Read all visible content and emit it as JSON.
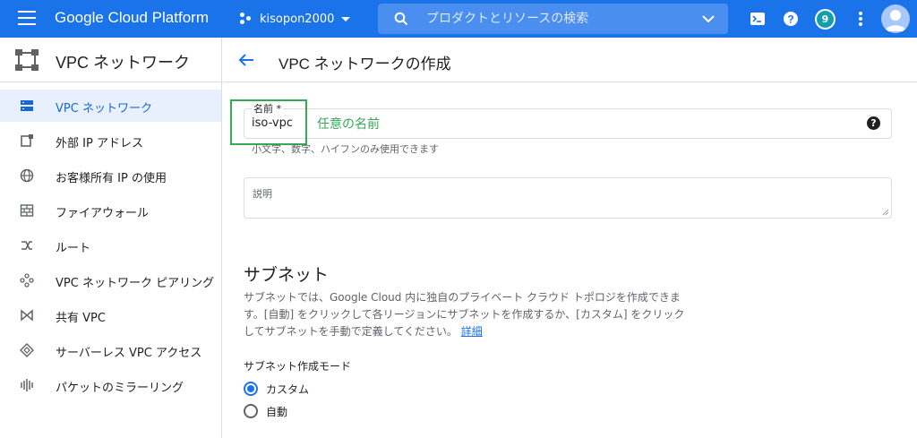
{
  "topbar": {
    "brand": "Google Cloud Platform",
    "project": "kisopon2000",
    "search_placeholder": "プロダクトとリソースの検索",
    "notification_count": "9",
    "accent_color": "#1a73e8"
  },
  "sidebar": {
    "title": "VPC ネットワーク",
    "items": [
      {
        "label": "VPC ネットワーク",
        "icon": "vpc-network-icon",
        "active": true
      },
      {
        "label": "外部 IP アドレス",
        "icon": "external-ip-icon",
        "active": false
      },
      {
        "label": "お客様所有 IP の使用",
        "icon": "globe-icon",
        "active": false
      },
      {
        "label": "ファイアウォール",
        "icon": "firewall-icon",
        "active": false
      },
      {
        "label": "ルート",
        "icon": "routes-icon",
        "active": false
      },
      {
        "label": "VPC ネットワーク ピアリング",
        "icon": "peering-icon",
        "active": false
      },
      {
        "label": "共有 VPC",
        "icon": "shared-vpc-icon",
        "active": false
      },
      {
        "label": "サーバーレス VPC アクセス",
        "icon": "serverless-icon",
        "active": false
      },
      {
        "label": "パケットのミラーリング",
        "icon": "packet-mirroring-icon",
        "active": false
      }
    ]
  },
  "main": {
    "title": "VPC ネットワークの作成",
    "name_field": {
      "label": "名前 *",
      "value": "iso-vpc",
      "annotation": "任意の名前",
      "hint": "小文字、数字、ハイフンのみ使用できます"
    },
    "description_field": {
      "label": "説明"
    },
    "subnet": {
      "heading": "サブネット",
      "body": "サブネットでは、Google Cloud 内に独自のプライベート クラウド トポロジを作成できます。[自動] をクリックして各リージョンにサブネットを作成するか、[カスタム] をクリックしてサブネットを手動で定義してください。",
      "link": "詳細",
      "mode_label": "サブネット作成モード",
      "options": [
        {
          "label": "カスタム",
          "selected": true
        },
        {
          "label": "自動",
          "selected": false
        }
      ]
    }
  }
}
